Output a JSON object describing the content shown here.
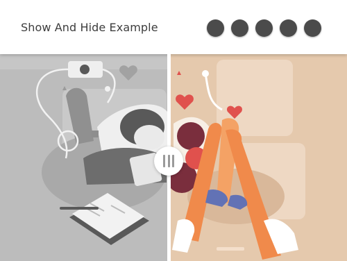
{
  "header": {
    "title": "Show And Hide Example"
  },
  "dots": [
    {
      "name": "nav-dot-1"
    },
    {
      "name": "nav-dot-2"
    },
    {
      "name": "nav-dot-3"
    },
    {
      "name": "nav-dot-4"
    },
    {
      "name": "nav-dot-5"
    }
  ],
  "slider": {
    "split_fraction": 0.485
  },
  "colors": {
    "dot": "#4b4b4b",
    "after_bg": "#e5c9ad",
    "before_bg": "#bcbcbc",
    "legs": "#f08a4b",
    "hearts": "#e0514d"
  }
}
